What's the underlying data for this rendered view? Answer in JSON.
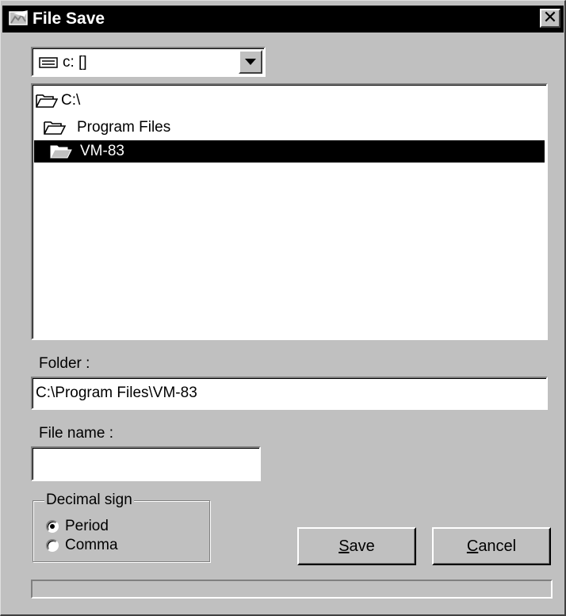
{
  "window": {
    "title": "File Save",
    "close_glyph": "✕"
  },
  "drive": {
    "icon": "drive-icon",
    "selected": "c: []"
  },
  "folders": {
    "items": [
      {
        "label": "C:\\",
        "icon": "folder-open-icon"
      },
      {
        "label": "Program Files",
        "icon": "folder-open-icon"
      },
      {
        "label": "VM-83",
        "icon": "folder-open-icon",
        "selected": true
      }
    ]
  },
  "folder_field": {
    "label": "Folder :",
    "value": "C:\\Program Files\\VM-83"
  },
  "filename_field": {
    "label": "File name :",
    "value": ""
  },
  "decimal": {
    "legend": "Decimal sign",
    "options": [
      {
        "label": "Period",
        "checked": true
      },
      {
        "label": "Comma",
        "checked": false
      }
    ]
  },
  "buttons": {
    "save_mnemonic": "S",
    "save_rest": "ave",
    "cancel_mnemonic": "C",
    "cancel_rest": "ancel"
  },
  "progress": {
    "value": 0
  },
  "colors": {
    "face": "#c0c0c0",
    "titlebar": "#000000",
    "selection": "#000000"
  }
}
